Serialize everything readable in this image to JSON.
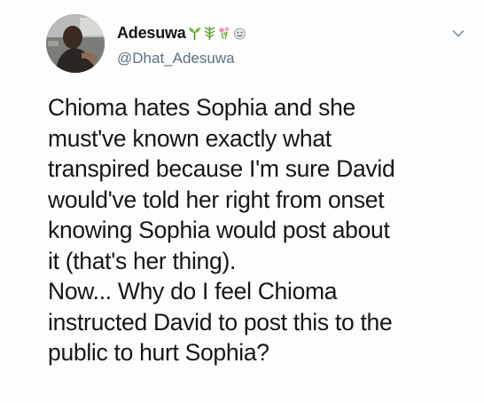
{
  "tweet": {
    "author": {
      "display_name": "Adesuwa",
      "handle": "@Dhat_Adesuwa",
      "name_emoji_icons": [
        "seedling-icon",
        "herb-icon",
        "flowers-icon",
        "smiley-icon"
      ]
    },
    "text": "Chioma hates Sophia and she\nmust've known exactly what\ntranspired because I'm sure David\nwould've told her right from onset\nknowing Sophia would post about\nit (that's her thing).\nNow... Why do I feel Chioma\ninstructed David to post this to the\npublic to hurt Sophia?",
    "menu_icon": "chevron-down-icon"
  },
  "colors": {
    "text": "#14171a",
    "handle": "#5b7083",
    "background": "#fdfdfd"
  }
}
